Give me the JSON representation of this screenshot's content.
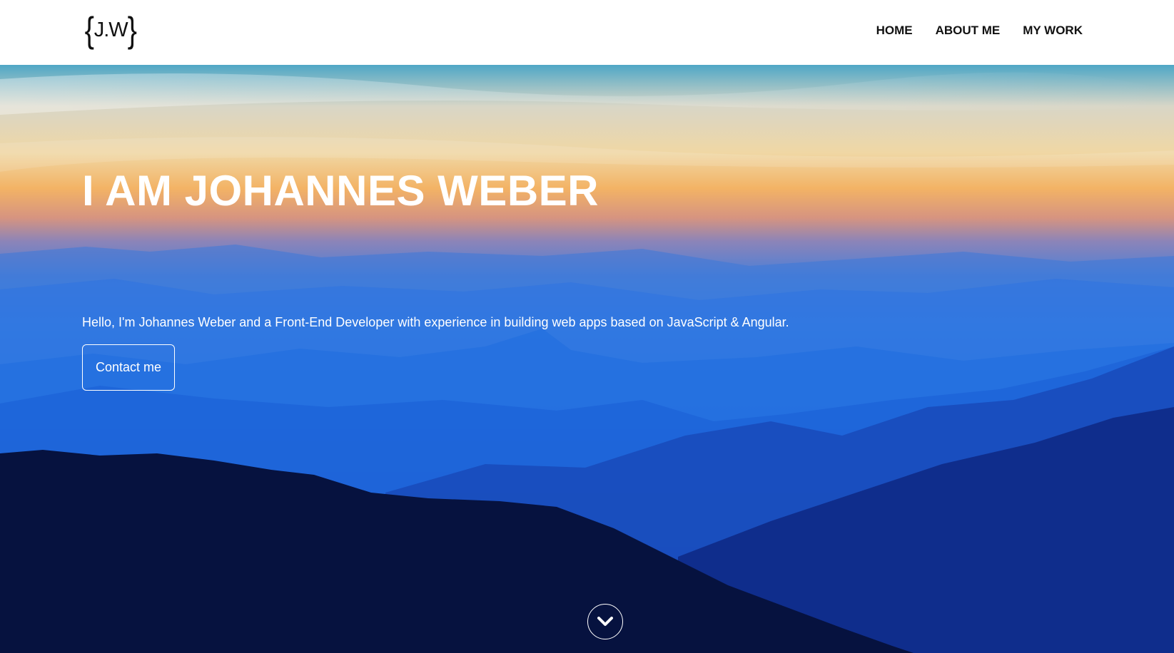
{
  "header": {
    "logo": {
      "brace_open": "{",
      "initials": "J.W",
      "brace_close": "}"
    },
    "nav": [
      {
        "label": "HOME"
      },
      {
        "label": "ABOUT ME"
      },
      {
        "label": "MY WORK"
      }
    ]
  },
  "hero": {
    "title": "I AM JOHANNES WEBER",
    "subtitle": "Hello, I'm Johannes Weber and a Front-End Developer with experience in building web apps based on JavaScript & Angular.",
    "cta_label": "Contact me",
    "scroll_icon": "chevron-down-icon",
    "background": "mountain-sunset-photo"
  },
  "colors": {
    "nav_text": "#111111",
    "hero_text": "#ffffff",
    "sky_orange": "#f3b365",
    "mountain_blue": "#1d78e8",
    "forest_dark": "#071850"
  }
}
